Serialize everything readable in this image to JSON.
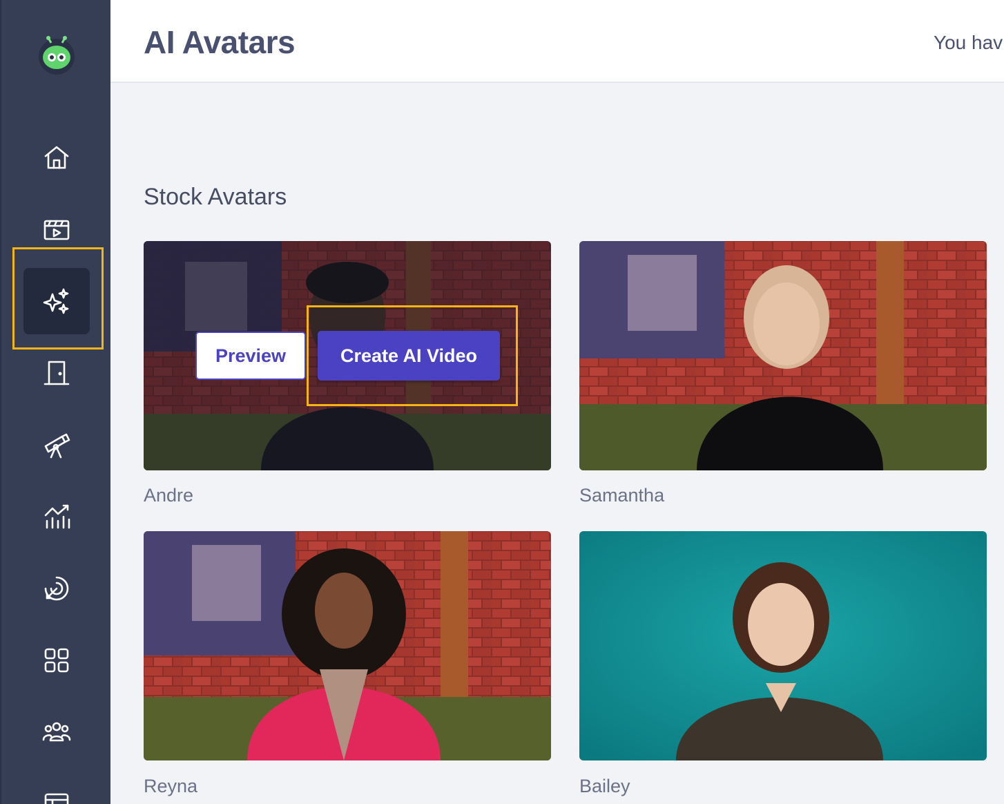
{
  "header": {
    "title": "AI Avatars",
    "credits_text": "You hav"
  },
  "sidebar": {
    "items": [
      {
        "icon": "home-icon"
      },
      {
        "icon": "video-clapper-icon"
      },
      {
        "icon": "sparkles-icon",
        "active": true
      },
      {
        "icon": "door-icon"
      },
      {
        "icon": "telescope-icon"
      },
      {
        "icon": "analytics-icon"
      },
      {
        "icon": "target-icon"
      },
      {
        "icon": "grid-icon"
      },
      {
        "icon": "team-icon"
      },
      {
        "icon": "layout-icon"
      }
    ]
  },
  "main": {
    "section_title": "Stock Avatars",
    "avatars": [
      {
        "name": "Andre",
        "background": "brick-wall",
        "hovered": true
      },
      {
        "name": "Samantha",
        "background": "brick-wall"
      },
      {
        "name": "Reyna",
        "background": "brick-wall"
      },
      {
        "name": "Bailey",
        "background": "teal"
      }
    ],
    "hover_actions": {
      "preview_label": "Preview",
      "create_label": "Create AI Video"
    }
  },
  "colors": {
    "sidebar_bg": "#363e55",
    "sidebar_active_bg": "#232a3d",
    "accent": "#4a42c2",
    "highlight": "#f6b417"
  }
}
